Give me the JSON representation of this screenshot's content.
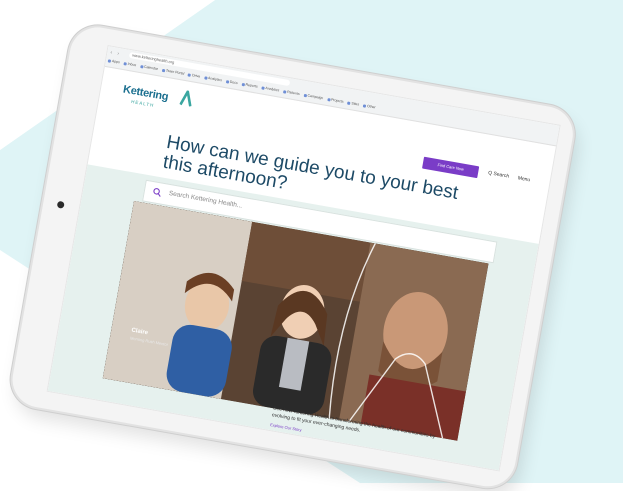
{
  "browser": {
    "url": "www.ketteringhealth.org",
    "bookmarks": [
      "Apps",
      "Inbox",
      "Calendar",
      "Team Portal",
      "Drive",
      "Analytics",
      "Docs",
      "Reports",
      "Analytics",
      "Patients",
      "Campaign",
      "Projects",
      "Sites",
      "Other"
    ]
  },
  "logo": {
    "name": "Kettering",
    "sub": "HEALTH"
  },
  "header": {
    "apply_label": "Find Care Now",
    "search_label": "Q Search",
    "menu_label": "Menu"
  },
  "hero": {
    "heading": "How can we guide you to your best this afternoon?",
    "search_placeholder": "Search Kettering Health..."
  },
  "photo": {
    "caption_name": "Claire",
    "caption_role": "Morning Rush Mentor"
  },
  "story": {
    "blurb": "See how Kettering Health is transforming the health of our communities by evolving to fit your ever-changing needs.",
    "link": "Explore Our Story"
  },
  "colors": {
    "brand_blue": "#1d4a66",
    "accent_purple": "#7a3cc7",
    "mint": "#e6f1ee",
    "background_teal": "#dff4f6"
  },
  "icons": [
    "search-icon",
    "logo-mark-icon"
  ]
}
